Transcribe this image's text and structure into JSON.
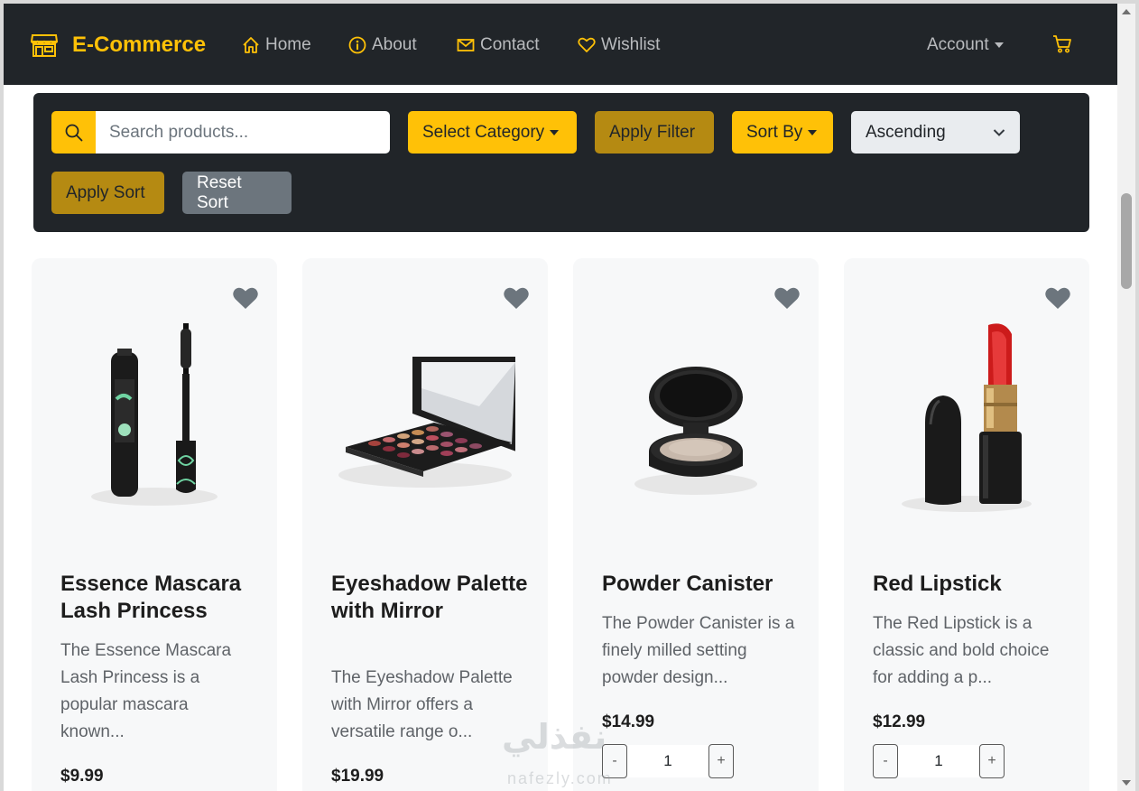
{
  "navbar": {
    "brand": "E-Commerce",
    "links": [
      {
        "label": "Home",
        "icon": "home-icon"
      },
      {
        "label": "About",
        "icon": "info-icon"
      },
      {
        "label": "Contact",
        "icon": "envelope-icon"
      },
      {
        "label": "Wishlist",
        "icon": "heart-outline-icon"
      }
    ],
    "account_label": "Account",
    "cart_icon": "cart-icon"
  },
  "filters": {
    "search_placeholder": "Search products...",
    "search_value": "",
    "category_label": "Select Category",
    "apply_filter_label": "Apply Filter",
    "sort_by_label": "Sort By",
    "order_selected": "Ascending",
    "apply_sort_label": "Apply Sort",
    "reset_sort_label": "Reset Sort"
  },
  "products": [
    {
      "title": "Essence Mascara Lash Princess",
      "description": "The Essence Mascara Lash Princess is a popular mascara known...",
      "price": "$9.99",
      "image": "mascara-image"
    },
    {
      "title": "Eyeshadow Palette with Mirror",
      "description": "The Eyeshadow Palette with Mirror offers a versatile range o...",
      "price": "$19.99",
      "image": "eyeshadow-palette-image"
    },
    {
      "title": "Powder Canister",
      "description": "The Powder Canister is a finely milled setting powder design...",
      "price": "$14.99",
      "quantity": "1",
      "image": "powder-canister-image"
    },
    {
      "title": "Red Lipstick",
      "description": "The Red Lipstick is a classic and bold choice for adding a p...",
      "price": "$12.99",
      "quantity": "1",
      "image": "lipstick-image"
    }
  ],
  "qty_controls": {
    "minus": "-",
    "plus": "+"
  },
  "watermark": {
    "logo_text": "نفذلي",
    "text": "nafezly.com"
  },
  "colors": {
    "navbar_bg": "#212529",
    "accent": "#ffc107",
    "accent_dark": "#b58a12",
    "secondary": "#6c757d",
    "card_bg": "#f7f8f9"
  }
}
